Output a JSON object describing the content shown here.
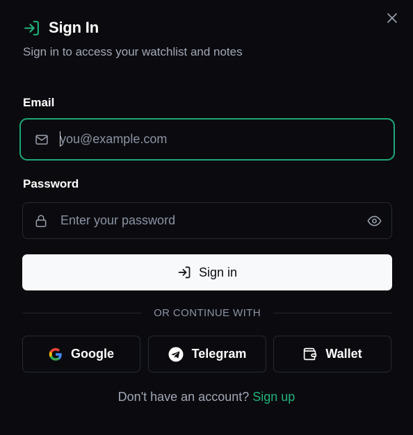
{
  "dialog": {
    "title": "Sign In",
    "subtitle": "Sign in to access your watchlist and notes",
    "close_icon": "x-icon",
    "title_icon": "log-in-icon"
  },
  "email": {
    "label": "Email",
    "placeholder": "you@example.com",
    "value": "",
    "icon": "mail-icon",
    "focused": true
  },
  "password": {
    "label": "Password",
    "placeholder": "Enter your password",
    "value": "",
    "icon": "lock-icon",
    "toggle_icon": "eye-icon"
  },
  "submit": {
    "label": "Sign in",
    "icon": "log-in-icon"
  },
  "divider": {
    "text": "OR CONTINUE WITH"
  },
  "providers": [
    {
      "label": "Google",
      "icon": "google-icon"
    },
    {
      "label": "Telegram",
      "icon": "telegram-icon"
    },
    {
      "label": "Wallet",
      "icon": "wallet-icon"
    }
  ],
  "footer": {
    "prompt": "Don't have an account?",
    "link": "Sign up"
  },
  "colors": {
    "background": "#0b0b0f",
    "accent": "#22b37c",
    "focus_border": "#1fa878",
    "border": "#262a33",
    "muted_text": "#a1a8b6",
    "button_bg": "#f8f9fb"
  }
}
